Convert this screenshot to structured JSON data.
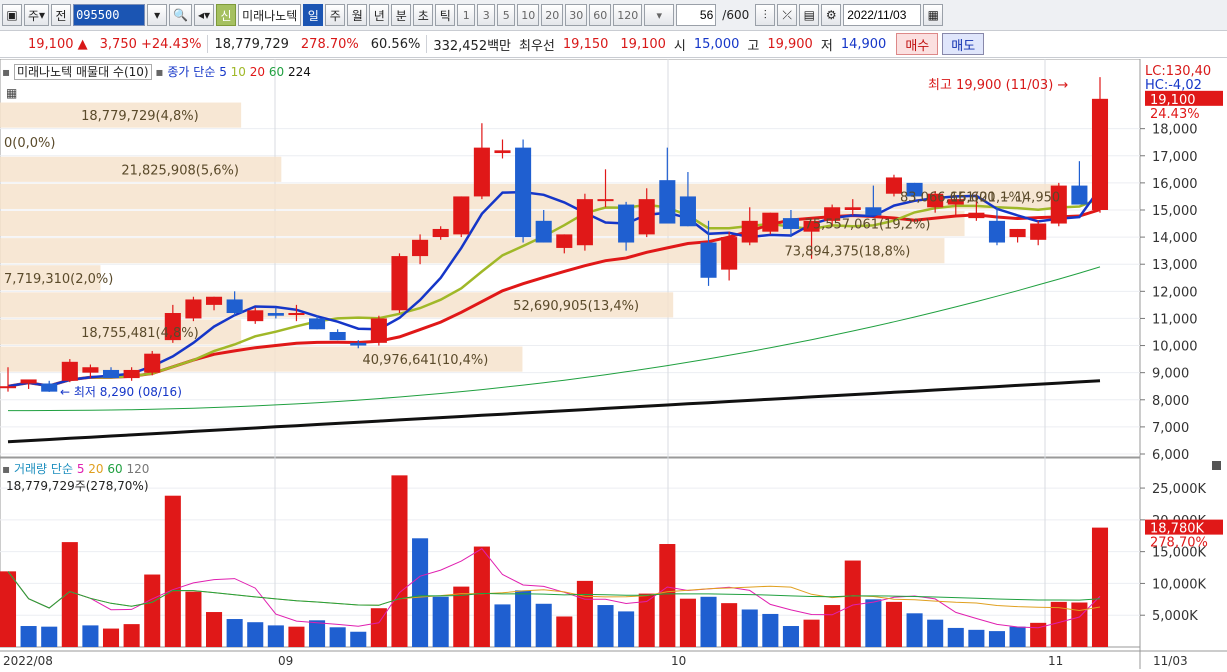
{
  "toolbar": {
    "type_label": "주",
    "market_label": "전",
    "code": "095500",
    "stock_name": "미래나노텍",
    "new_badge": "신",
    "periods": [
      "일",
      "주",
      "월",
      "년",
      "분",
      "초",
      "틱"
    ],
    "active_period": "일",
    "intervals": [
      "1",
      "3",
      "5",
      "10",
      "20",
      "30",
      "60",
      "120"
    ],
    "count": "56",
    "count_total": "/600",
    "date": "2022/11/03"
  },
  "quote": {
    "price": "19,100",
    "arrow": "▲",
    "change": "3,750",
    "change_pct": "+24.43%",
    "volume": "18,779,729",
    "vol_ratio": "278.70%",
    "turnover": "60.56%",
    "amount": "332,452백만",
    "best_label": "최우선",
    "ask": "19,150",
    "bid": "19,100",
    "open_label": "시",
    "open": "15,000",
    "high_label": "고",
    "high": "19,900",
    "low_label": "저",
    "low": "14,900",
    "buy": "매수",
    "sell": "매도"
  },
  "price_legend": {
    "title": "미래나노텍 매물대 수(10)",
    "series_label": "종가 단순",
    "ma": [
      "5",
      "10",
      "20",
      "60",
      "224"
    ]
  },
  "volume_legend": {
    "title": "거래량 단순",
    "ma": [
      "5",
      "20",
      "60",
      "120"
    ],
    "current": "18,779,729주(278,70%)"
  },
  "annotations": {
    "high": "최고 19,900 (11/03)",
    "low": "최저 8,290 (08/16)",
    "lc": "LC:130,40",
    "hc": "HC:-4,02",
    "last_price": "19,100",
    "last_pct": "24.43%",
    "last_vol": "18,780K",
    "last_vol_pct": "278,70%"
  },
  "volume_profile": [
    {
      "label": "18,779,729(4,8%)",
      "price": 18500,
      "share": 4.8
    },
    {
      "label": "0(0,0%)",
      "price": 17500,
      "share": 0.0
    },
    {
      "label": "21,825,908(5,6%)",
      "price": 16500,
      "share": 5.6
    },
    {
      "label": "83,066,651(21,1%)",
      "price": 15500,
      "share": 21.1
    },
    {
      "label": "75,557,061(19,2%)",
      "price": 14500,
      "share": 19.2
    },
    {
      "label": "73,894,375(18,8%)",
      "price": 13500,
      "share": 18.8
    },
    {
      "label": "7,719,310(2,0%)",
      "price": 12500,
      "share": 2.0
    },
    {
      "label": "52,690,905(13,4%)",
      "price": 11500,
      "share": 13.4
    },
    {
      "label": "18,755,481(4,8%)",
      "price": 10500,
      "share": 4.8
    },
    {
      "label": "40,976,641(10,4%)",
      "price": 9500,
      "share": 10.4
    }
  ],
  "range_label": "16,600 ~ 14,950",
  "chart_data": {
    "type": "candlestick",
    "price_axis": [
      "18,000",
      "17,000",
      "16,000",
      "15,000",
      "14,000",
      "13,000",
      "12,000",
      "11,000",
      "10,000",
      "9,000",
      "8,000",
      "7,000",
      "6,000"
    ],
    "volume_axis": [
      "25,000K",
      "20,000K",
      "15,000K",
      "10,000K",
      "5,000K"
    ],
    "x_labels": [
      "2022/08",
      "09",
      "10",
      "11",
      "11/03"
    ],
    "candles": [
      [
        8500,
        9200,
        8300,
        8500
      ],
      [
        8600,
        8700,
        8400,
        8750
      ],
      [
        8600,
        8700,
        8290,
        8300
      ],
      [
        8700,
        9500,
        8650,
        9400
      ],
      [
        9000,
        9300,
        8800,
        9200
      ],
      [
        9100,
        9200,
        8900,
        8800
      ],
      [
        8800,
        9200,
        8700,
        9100
      ],
      [
        9000,
        9800,
        8900,
        9700
      ],
      [
        10200,
        11500,
        10100,
        11200
      ],
      [
        11000,
        11800,
        10900,
        11700
      ],
      [
        11500,
        11800,
        11300,
        11800
      ],
      [
        11700,
        12000,
        11100,
        11200
      ],
      [
        10900,
        11400,
        10800,
        11300
      ],
      [
        11200,
        11400,
        11000,
        11100
      ],
      [
        11200,
        11500,
        10900,
        11200
      ],
      [
        11000,
        11100,
        10600,
        10600
      ],
      [
        10500,
        10600,
        10200,
        10200
      ],
      [
        10100,
        10200,
        9900,
        10000
      ],
      [
        10100,
        11100,
        10000,
        11000
      ],
      [
        11300,
        13400,
        11200,
        13300
      ],
      [
        13300,
        14100,
        13000,
        13900
      ],
      [
        14000,
        14400,
        13900,
        14300
      ],
      [
        14100,
        15500,
        14000,
        15500
      ],
      [
        15500,
        18200,
        15400,
        17300
      ],
      [
        17100,
        17600,
        16900,
        17200
      ],
      [
        17300,
        17600,
        13800,
        14000
      ],
      [
        14600,
        15000,
        13800,
        13800
      ],
      [
        13600,
        14100,
        13400,
        14100
      ],
      [
        13700,
        15600,
        13500,
        15400
      ],
      [
        15400,
        16500,
        15100,
        15400
      ],
      [
        15200,
        15300,
        13500,
        13800
      ],
      [
        14100,
        15800,
        14000,
        15400
      ],
      [
        16100,
        17300,
        15000,
        14500
      ],
      [
        15500,
        16400,
        14400,
        14400
      ],
      [
        13800,
        14600,
        12200,
        12500
      ],
      [
        12800,
        14200,
        12400,
        14000
      ],
      [
        13800,
        15100,
        13700,
        14600
      ],
      [
        14200,
        14900,
        14100,
        14900
      ],
      [
        14700,
        15000,
        14000,
        14300
      ],
      [
        14200,
        14600,
        13200,
        14600
      ],
      [
        14600,
        15200,
        14400,
        15100
      ],
      [
        15000,
        15400,
        14800,
        15100
      ],
      [
        15100,
        15900,
        14900,
        14800
      ],
      [
        15600,
        16300,
        15500,
        16200
      ],
      [
        16000,
        16000,
        15400,
        15500
      ],
      [
        15100,
        15700,
        14900,
        15600
      ],
      [
        15200,
        15400,
        14800,
        15400
      ],
      [
        14700,
        15600,
        14600,
        14900
      ],
      [
        14600,
        15100,
        13700,
        13800
      ],
      [
        14000,
        14300,
        13800,
        14300
      ],
      [
        13900,
        14600,
        13700,
        14500
      ],
      [
        14500,
        16000,
        14400,
        15900
      ],
      [
        15900,
        16800,
        15300,
        15200
      ],
      [
        15000,
        19900,
        14900,
        19100
      ]
    ],
    "volumes": [
      11900,
      3300,
      3200,
      16500,
      3400,
      2900,
      3600,
      11400,
      23800,
      8700,
      5500,
      4400,
      3900,
      3400,
      3200,
      4200,
      3100,
      2400,
      6100,
      27000,
      17100,
      7900,
      9500,
      15800,
      6700,
      8900,
      6800,
      4800,
      10400,
      6600,
      5600,
      8400,
      16200,
      7600,
      7900,
      6900,
      5900,
      5200,
      3300,
      4300,
      6600,
      13600,
      7500,
      7100,
      5300,
      4300,
      3000,
      2700,
      2500,
      3200,
      3800,
      7100,
      7000,
      18780
    ],
    "volume_up": [
      true,
      false,
      false,
      true,
      false,
      true,
      true,
      true,
      true,
      true,
      true,
      false,
      false,
      false,
      true,
      false,
      false,
      false,
      true,
      true,
      false,
      false,
      true,
      true,
      false,
      false,
      false,
      true,
      true,
      false,
      false,
      true,
      true,
      true,
      false,
      true,
      false,
      false,
      false,
      true,
      true,
      true,
      false,
      true,
      false,
      false,
      false,
      false,
      false,
      false,
      true,
      true,
      true,
      true
    ],
    "ylim": [
      6000,
      20200
    ],
    "vol_ylim": [
      0,
      28000
    ]
  }
}
